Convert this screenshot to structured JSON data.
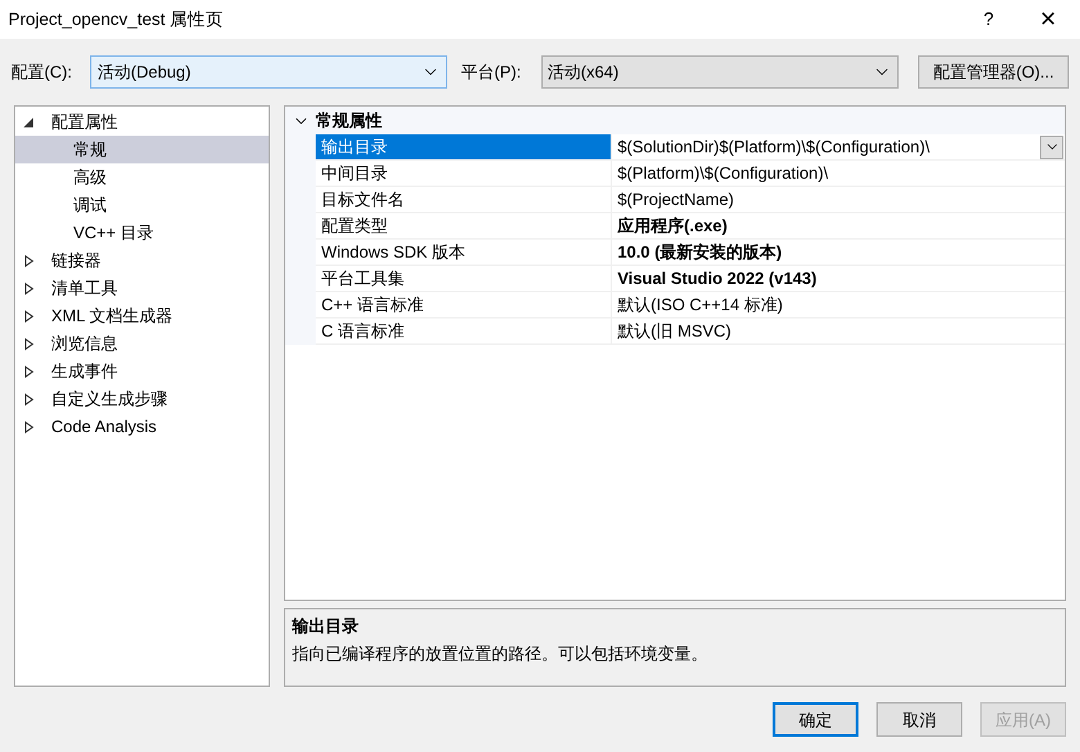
{
  "window": {
    "title": "Project_opencv_test 属性页",
    "help": "?",
    "close": "×"
  },
  "toolbar": {
    "config_label": "配置(C):",
    "config_value": "活动(Debug)",
    "platform_label": "平台(P):",
    "platform_value": "活动(x64)",
    "manager_button": "配置管理器(O)..."
  },
  "tree": [
    {
      "label": "配置属性",
      "expanded": true,
      "children": [
        {
          "label": "常规",
          "selected": true
        },
        {
          "label": "高级",
          "selected": false
        },
        {
          "label": "调试",
          "selected": false
        },
        {
          "label": "VC++ 目录",
          "selected": false
        }
      ]
    },
    {
      "label": "链接器",
      "expanded": false
    },
    {
      "label": "清单工具",
      "expanded": false
    },
    {
      "label": "XML 文档生成器",
      "expanded": false
    },
    {
      "label": "浏览信息",
      "expanded": false
    },
    {
      "label": "生成事件",
      "expanded": false
    },
    {
      "label": "自定义生成步骤",
      "expanded": false
    },
    {
      "label": "Code Analysis",
      "expanded": false
    }
  ],
  "grid": {
    "category": "常规属性",
    "expanded": true,
    "rows": [
      {
        "name": "输出目录",
        "value": "$(SolutionDir)$(Platform)\\$(Configuration)\\",
        "selected": true,
        "modified": false
      },
      {
        "name": "中间目录",
        "value": "$(Platform)\\$(Configuration)\\",
        "selected": false,
        "modified": false
      },
      {
        "name": "目标文件名",
        "value": "$(ProjectName)",
        "selected": false,
        "modified": false
      },
      {
        "name": "配置类型",
        "value": "应用程序(.exe)",
        "selected": false,
        "modified": true
      },
      {
        "name": "Windows SDK 版本",
        "value": "10.0 (最新安装的版本)",
        "selected": false,
        "modified": true
      },
      {
        "name": "平台工具集",
        "value": "Visual Studio 2022 (v143)",
        "selected": false,
        "modified": true
      },
      {
        "name": "C++ 语言标准",
        "value": "默认(ISO C++14 标准)",
        "selected": false,
        "modified": false
      },
      {
        "name": "C 语言标准",
        "value": "默认(旧 MSVC)",
        "selected": false,
        "modified": false
      }
    ]
  },
  "description": {
    "title": "输出目录",
    "text": "指向已编译程序的放置位置的路径。可以包括环境变量。"
  },
  "buttons": [
    {
      "label": "确定",
      "default": true,
      "disabled": false
    },
    {
      "label": "取消",
      "default": false,
      "disabled": false
    },
    {
      "label": "应用(A)",
      "default": false,
      "disabled": true
    }
  ]
}
